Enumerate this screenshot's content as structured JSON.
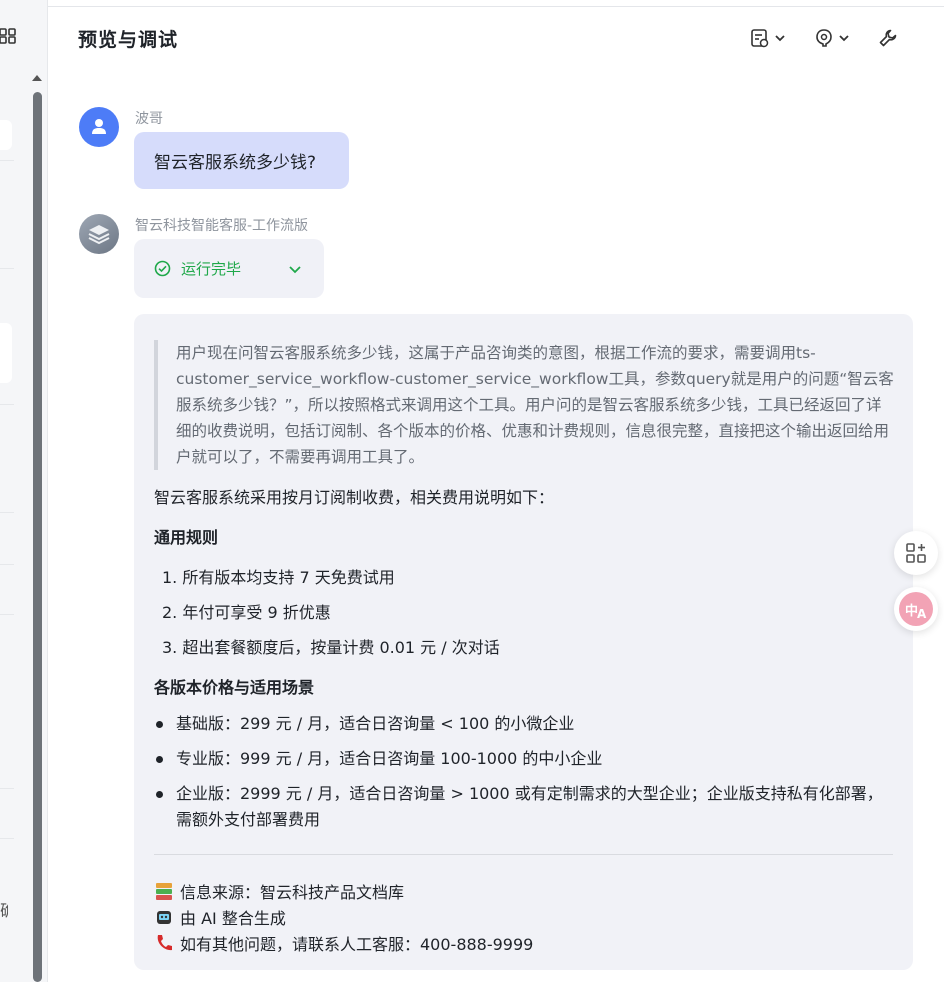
{
  "header": {
    "title": "预览与调试"
  },
  "left": {
    "cut_char": "确"
  },
  "chat": {
    "user_name": "波哥",
    "user_message": "智云客服系统多少钱?",
    "bot_name": "智云科技智能客服-工作流版",
    "status": "运行完毕",
    "thinking": "用户现在问智云客服系统多少钱，这属于产品咨询类的意图，根据工作流的要求，需要调用ts-customer_service_workflow-customer_service_workflow工具，参数query就是用户的问题“智云客服系统多少钱？”，所以按照格式来调用这个工具。用户问的是智云客服系统多少钱，工具已经返回了详细的收费说明，包括订阅制、各个版本的价格、优惠和计费规则，信息很完整，直接把这个输出返回给用户就可以了，不需要再调用工具了。",
    "intro": "智云客服系统采用按月订阅制收费，相关费用说明如下：",
    "section1_title": "通用规则",
    "rules": [
      "1. 所有版本均支持 7 天免费试用",
      "2. 年付可享受 9 折优惠",
      "3. 超出套餐额度后，按量计费 0.01 元 / 次对话"
    ],
    "section2_title": "各版本价格与适用场景",
    "plans": [
      "基础版：299 元 / 月，适合日咨询量 < 100 的小微企业",
      "专业版：999 元 / 月，适合日咨询量 100-1000 的中小企业",
      "企业版：2999 元 / 月，适合日咨询量 > 1000 或有定制需求的大型企业；企业版支持私有化部署，需额外支付部署费用"
    ],
    "footer": {
      "source": "信息来源：智云科技产品文档库",
      "generated": "由 AI 整合生成",
      "contact": "如有其他问题，请联系人工客服：400-888-9999"
    }
  },
  "icons": {
    "header": [
      "task-list-icon",
      "bug-feedback-icon",
      "wrench-icon"
    ],
    "floating": [
      "apps-plus-icon",
      "translate-icon"
    ]
  },
  "colors": {
    "user_bubble": "#d6dcfb",
    "answer_bg": "#f1f2f7",
    "status_green": "#1fa84a",
    "user_avatar": "#4d7cf7"
  }
}
